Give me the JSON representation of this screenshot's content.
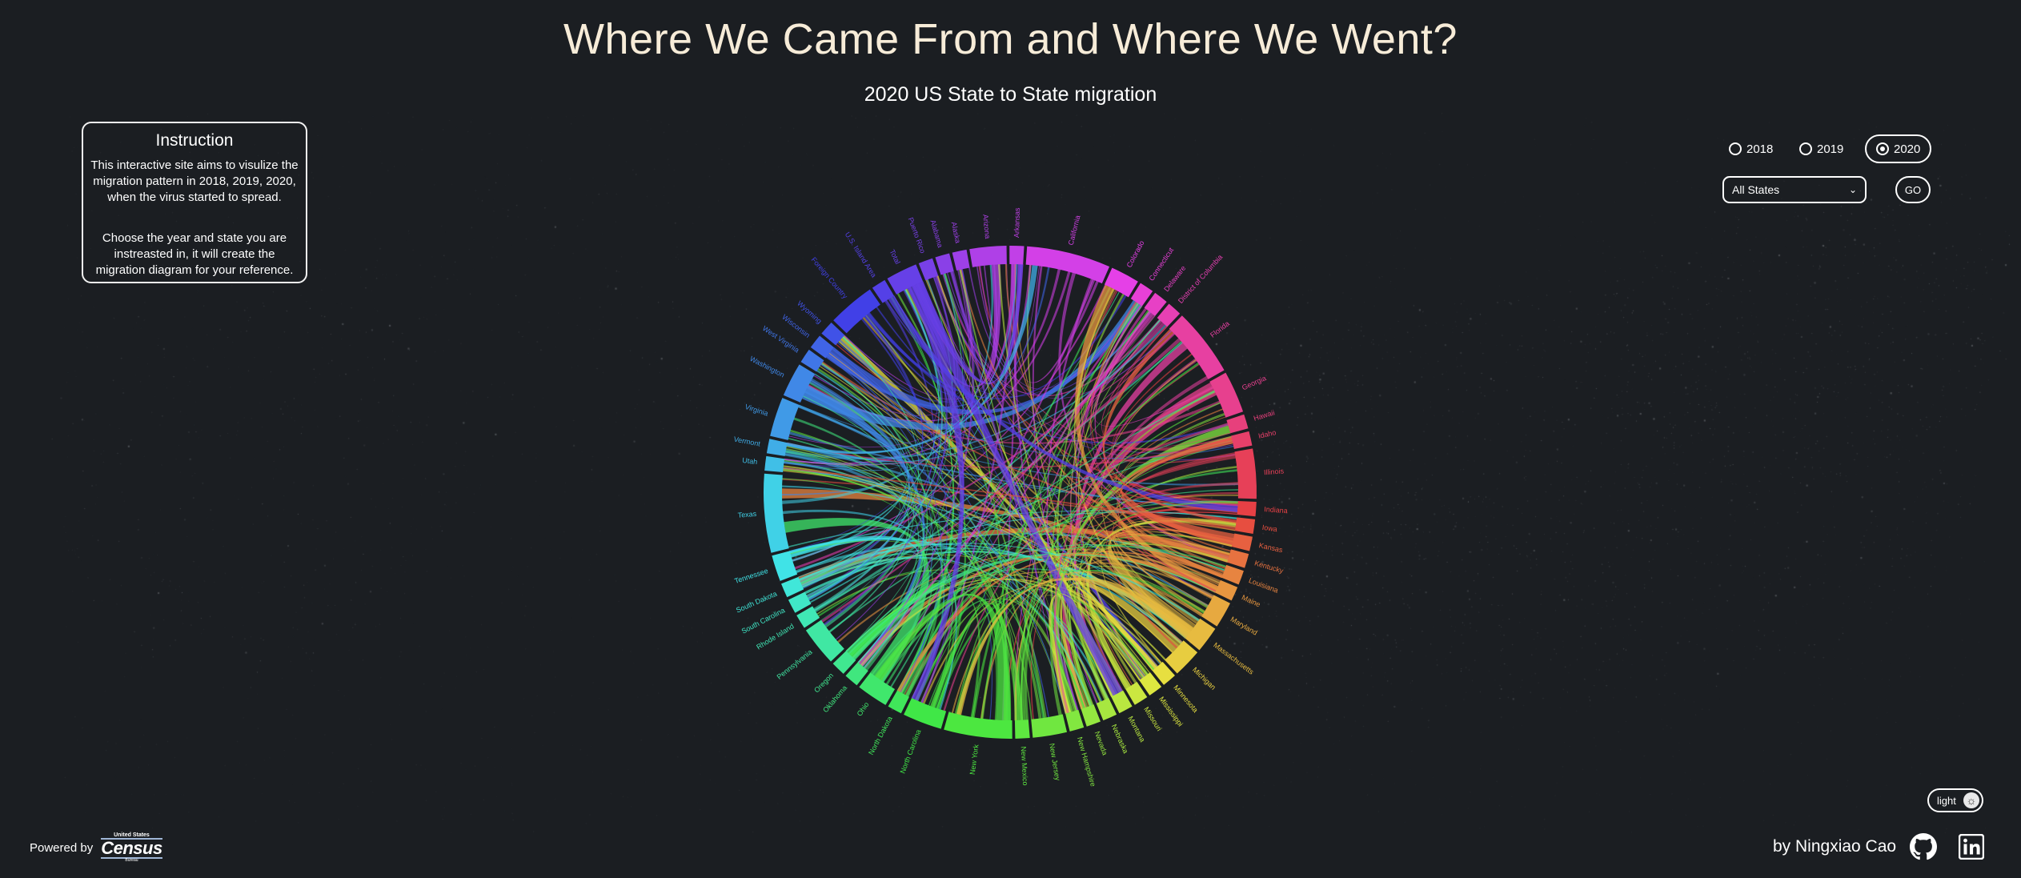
{
  "page": {
    "title": "Where We Came From and Where We Went?",
    "subtitle": "2020 US State to State migration"
  },
  "instruction": {
    "heading": "Instruction",
    "paragraph1": "This interactive site aims to visulize the migration pattern in 2018, 2019, 2020, when the virus started to spread.",
    "paragraph2": "Choose the year and state you are instreasted in, it will create the migration diagram for your reference."
  },
  "controls": {
    "years": [
      "2018",
      "2019",
      "2020"
    ],
    "selected_year": "2020",
    "state_select_value": "All States",
    "go_label": "GO"
  },
  "theme_toggle": {
    "label": "light",
    "icon": "sun-icon"
  },
  "footer": {
    "powered_by": "Powered by",
    "census_logo": {
      "line1": "United States",
      "word": "Census",
      "line3": "Bureau"
    },
    "author": "by Ningxiao Cao",
    "github_icon": "github-icon",
    "linkedin_icon": "linkedin-icon"
  },
  "colors": {
    "background": "#1b1e22",
    "title": "#f7ecd8",
    "text": "#ffffff"
  },
  "chord": {
    "states": [
      "Puerto Rico",
      "Alabama",
      "Alaska",
      "Arizona",
      "Arkansas",
      "California",
      "Colorado",
      "Connecticut",
      "Delaware",
      "District of Columbia",
      "Florida",
      "Georgia",
      "Hawaii",
      "Idaho",
      "Illinois",
      "Indiana",
      "Iowa",
      "Kansas",
      "Kentucky",
      "Louisiana",
      "Maine",
      "Maryland",
      "Massachusetts",
      "Michigan",
      "Minnesota",
      "Mississippi",
      "Missouri",
      "Montana",
      "Nebraska",
      "Nevada",
      "New Hampshire",
      "New Jersey",
      "New Mexico",
      "New York",
      "North Carolina",
      "North Dakota",
      "Ohio",
      "Oklahoma",
      "Oregon",
      "Pennsylvania",
      "Rhode Island",
      "South Carolina",
      "South Dakota",
      "Tennessee",
      "Texas",
      "Utah",
      "Vermont",
      "Virginia",
      "Washington",
      "West Virginia",
      "Wisconsin",
      "Wyoming",
      "Foreign Country",
      "U.S. Island Area",
      "Total"
    ]
  }
}
